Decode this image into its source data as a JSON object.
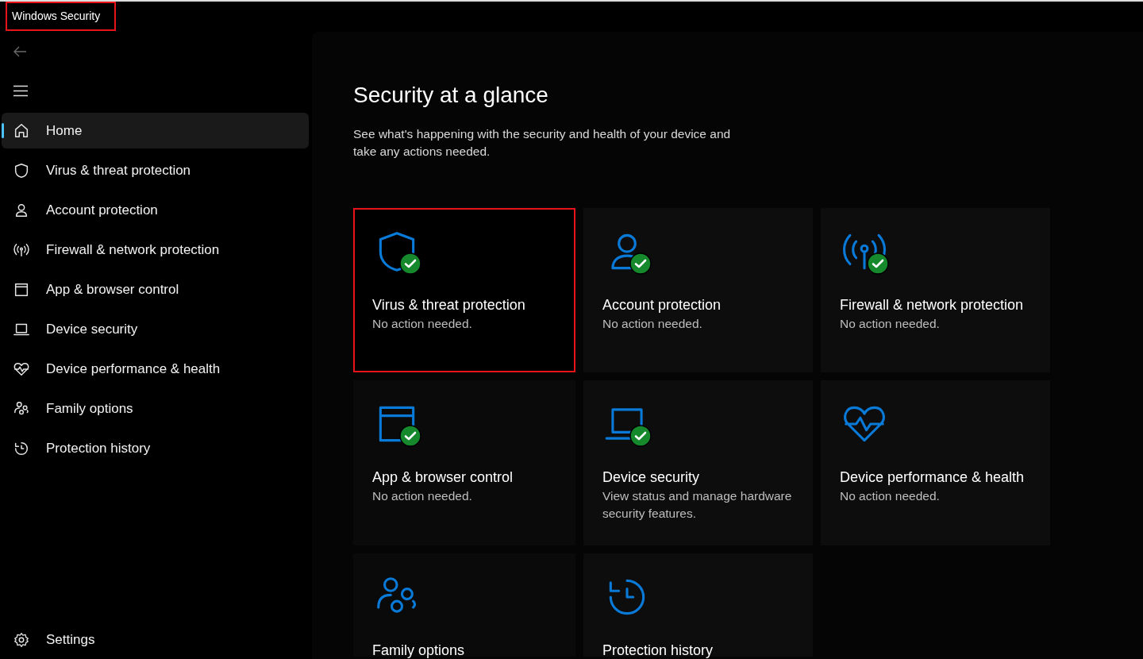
{
  "window": {
    "title": "Windows Security",
    "highlighted": true
  },
  "nav": {
    "items": [
      {
        "label": "Home",
        "kind": "home",
        "selected": true
      },
      {
        "label": "Virus & threat protection",
        "kind": "shield",
        "selected": false
      },
      {
        "label": "Account protection",
        "kind": "person",
        "selected": false
      },
      {
        "label": "Firewall & network protection",
        "kind": "antenna",
        "selected": false
      },
      {
        "label": "App & browser control",
        "kind": "window",
        "selected": false
      },
      {
        "label": "Device security",
        "kind": "laptop",
        "selected": false
      },
      {
        "label": "Device performance & health",
        "kind": "heart",
        "selected": false
      },
      {
        "label": "Family options",
        "kind": "family",
        "selected": false
      },
      {
        "label": "Protection history",
        "kind": "history",
        "selected": false
      }
    ],
    "settings": {
      "label": "Settings"
    }
  },
  "heading": "Security at a glance",
  "description": "See what's happening with the security and health of your device and take any actions needed.",
  "cards": [
    {
      "title": "Virus & threat protection",
      "status": "No action needed.",
      "kind": "shield",
      "checked": true,
      "highlighted": true
    },
    {
      "title": "Account protection",
      "status": "No action needed.",
      "kind": "person",
      "checked": true,
      "highlighted": false
    },
    {
      "title": "Firewall & network protection",
      "status": "No action needed.",
      "kind": "antenna",
      "checked": true,
      "highlighted": false
    },
    {
      "title": "App & browser control",
      "status": "No action needed.",
      "kind": "window",
      "checked": true,
      "highlighted": false
    },
    {
      "title": "Device security",
      "status": "View status and manage hardware security features.",
      "kind": "laptop",
      "checked": true,
      "highlighted": false
    },
    {
      "title": "Device performance & health",
      "status": "No action needed.",
      "kind": "heart",
      "checked": false,
      "highlighted": false
    },
    {
      "title": "Family options",
      "kind": "family",
      "checked": false,
      "highlighted": false
    },
    {
      "title": "Protection history",
      "kind": "history",
      "checked": false,
      "highlighted": false
    }
  ]
}
